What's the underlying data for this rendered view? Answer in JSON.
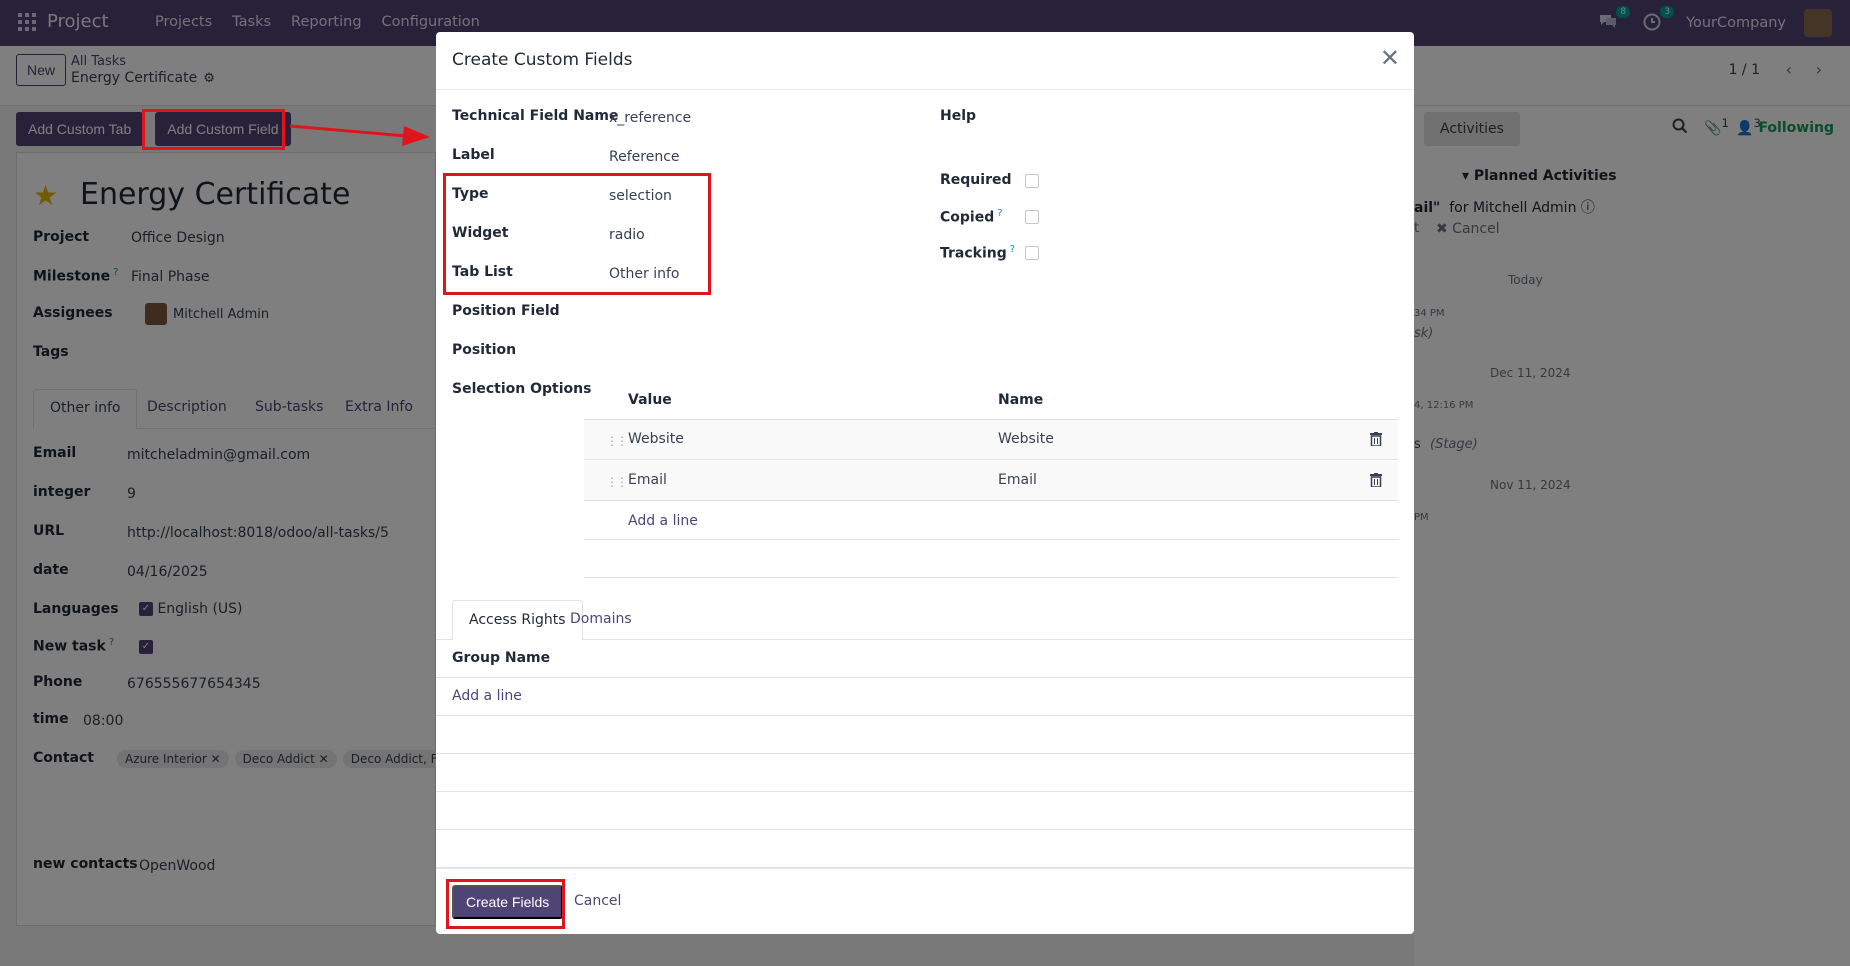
{
  "navbar": {
    "brand": "Project",
    "menu": [
      "Projects",
      "Tasks",
      "Reporting",
      "Configuration"
    ],
    "chat_badge": "8",
    "activity_badge": "3",
    "company": "YourCompany"
  },
  "control_panel": {
    "new_label": "New",
    "breadcrumb_parent": "All Tasks",
    "breadcrumb_current": "Energy Certificate",
    "pager": "1 / 1"
  },
  "toolbar": {
    "add_tab_label": "Add Custom Tab",
    "add_field_label": "Add Custom Field"
  },
  "task": {
    "title": "Energy Certificate",
    "fields": [
      {
        "label": "Project",
        "value": "Office Design"
      },
      {
        "label": "Milestone",
        "value": "Final Phase",
        "help": "?"
      },
      {
        "label": "Assignees",
        "value": "Mitchell Admin"
      },
      {
        "label": "Tags",
        "value": ""
      }
    ],
    "tabs": [
      "Other info",
      "Description",
      "Sub-tasks",
      "Extra Info"
    ],
    "other_info": [
      {
        "label": "Email",
        "value": "mitcheladmin@gmail.com"
      },
      {
        "label": "integer",
        "value": "9"
      },
      {
        "label": "URL",
        "value": "http://localhost:8018/odoo/all-tasks/5"
      },
      {
        "label": "date",
        "value": "04/16/2025"
      },
      {
        "label": "Languages",
        "value": "English (US)"
      },
      {
        "label": "New task",
        "value": "",
        "help": "?"
      },
      {
        "label": "Phone",
        "value": "676555677654345"
      },
      {
        "label": "time",
        "value": "08:00"
      },
      {
        "label": "Contact",
        "value": ""
      },
      {
        "label": "new contacts",
        "value": "OpenWood"
      }
    ],
    "contact_tags": [
      "Azure Interior ✕",
      "Deco Addict ✕",
      "Deco Addict, Floyd"
    ]
  },
  "chatter": {
    "activities_label": "Activities",
    "attachments_count": "1",
    "followers_count": "3",
    "following_label": "Following",
    "planned_activities": "Planned Activities",
    "activity_text_1": "ail\"",
    "activity_text_2": "for Mitchell Admin",
    "activity_text_3": "t",
    "activity_cancel": "✖ Cancel",
    "date_today": "Today",
    "msg_time_1": "34 PM",
    "msg_text_1": "sk)",
    "date_dec": "Dec 11, 2024",
    "msg_time_2": "4, 12:16 PM",
    "msg_text_2a": "s",
    "msg_text_2b": "(Stage)",
    "date_nov": "Nov 11, 2024",
    "msg_time_3": "PM"
  },
  "modal": {
    "title": "Create Custom Fields",
    "fields": [
      {
        "label": "Technical Field Name",
        "value": "x_reference"
      },
      {
        "label": "Label",
        "value": "Reference"
      },
      {
        "label": "Type",
        "value": "selection"
      },
      {
        "label": "Widget",
        "value": "radio"
      },
      {
        "label": "Tab List",
        "value": "Other info"
      },
      {
        "label": "Position Field",
        "value": ""
      },
      {
        "label": "Position",
        "value": ""
      }
    ],
    "help_label": "Help",
    "required_label": "Required",
    "copied_label": "Copied",
    "tracking_label": "Tracking",
    "help_mark": "?",
    "selection_label": "Selection Options",
    "options_header": {
      "value": "Value",
      "name": "Name"
    },
    "options": [
      {
        "value": "Website",
        "name": "Website"
      },
      {
        "value": "Email",
        "name": "Email"
      }
    ],
    "add_line": "Add a line",
    "tabs": [
      "Access Rights",
      "Domains"
    ],
    "group_name_header": "Group Name",
    "create_label": "Create Fields",
    "cancel_label": "Cancel"
  },
  "colors": {
    "brand": "#4e4575",
    "highlight": "#e0151b",
    "following": "#0f9d58"
  }
}
